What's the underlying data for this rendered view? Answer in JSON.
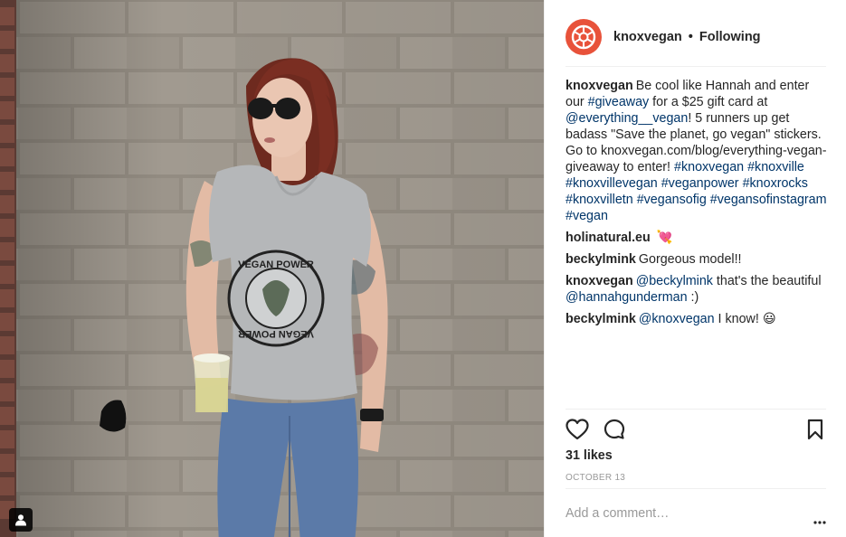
{
  "header": {
    "username": "knoxvegan",
    "separator": "•",
    "follow_status": "Following"
  },
  "caption": {
    "author": "knoxvegan",
    "text1": "Be cool like Hannah and enter our ",
    "link1": "#giveaway",
    "text2": " for a $25 gift card at ",
    "link2": "@everything__vegan",
    "text3": "! 5 runners up get badass \"Save the planet, go vegan\" stickers. Go to knoxvegan.com/blog/everything-vegan-giveaway to enter! ",
    "link3": "#knoxvegan",
    "link4": "#knoxville",
    "link5": "#knoxvillevegan",
    "link6": "#veganpower",
    "link7": "#knoxrocks",
    "link8": "#knoxvilletn",
    "link9": "#vegansofig",
    "link10": "#vegansofinstagram",
    "link11": "#vegan"
  },
  "comments": [
    {
      "author": "holinatural.eu",
      "emoji": "💘"
    },
    {
      "author": "beckylmink",
      "text": "Gorgeous model!!"
    },
    {
      "author": "knoxvegan",
      "mention": "@beckylmink",
      "text": " that's the beautiful ",
      "mention2": "@hannahgunderman",
      "text2": " :)"
    },
    {
      "author": "beckylmink",
      "mention": "@knoxvegan",
      "text": " I know! ",
      "emoji": "😃"
    }
  ],
  "stats": {
    "likes": "31 likes",
    "date": "OCTOBER 13"
  },
  "comment_input": {
    "placeholder": "Add a comment…"
  },
  "photo": {
    "shirt_text_top": "VEGAN POWER",
    "shirt_text_bottom": "VEGAN POWER"
  },
  "icons": {
    "avatar": "knoxvegan-logo-icon",
    "heart": "heart-icon",
    "comment": "comment-bubble-icon",
    "save": "bookmark-icon",
    "more": "more-options-icon",
    "user_tag": "user-tag-icon"
  },
  "colors": {
    "link": "#003569",
    "avatar_bg": "#e8523a",
    "meta_gray": "#999999"
  }
}
